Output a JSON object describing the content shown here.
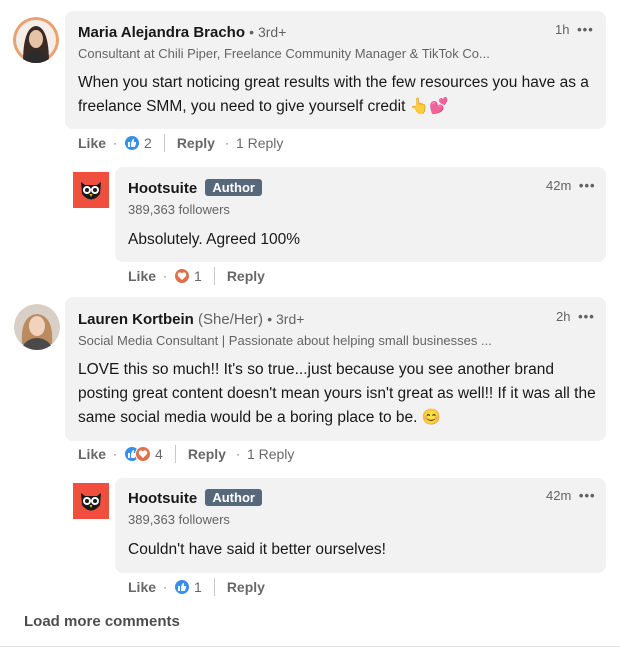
{
  "comments": [
    {
      "name": "Maria Alejandra Bracho",
      "degree": "• 3rd+",
      "headline": "Consultant at Chili Piper, Freelance Community Manager & TikTok Co...",
      "time": "1h",
      "more": "•••",
      "text": "When you start noticing great results with the few resources you have as a freelance SMM, you need to give yourself credit 👆💕",
      "like_label": "Like",
      "reaction_count": "2",
      "reply_label": "Reply",
      "reply_count": "1 Reply",
      "reply": {
        "name": "Hootsuite",
        "badge": "Author",
        "followers": "389,363 followers",
        "time": "42m",
        "more": "•••",
        "text": "Absolutely. Agreed 100%",
        "like_label": "Like",
        "reaction_count": "1",
        "reply_label": "Reply"
      }
    },
    {
      "name": "Lauren Kortbein",
      "pronouns": "(She/Her)",
      "degree": "• 3rd+",
      "headline": "Social Media Consultant | Passionate about helping small businesses ...",
      "time": "2h",
      "more": "•••",
      "text": "LOVE this so much!! It's so true...just because you see another brand posting great content doesn't mean yours isn't great as well!! If it was all the same social media would be a boring place to be. 😊",
      "like_label": "Like",
      "reaction_count": "4",
      "reply_label": "Reply",
      "reply_count": "1 Reply",
      "reply": {
        "name": "Hootsuite",
        "badge": "Author",
        "followers": "389,363 followers",
        "time": "42m",
        "more": "•••",
        "text": "Couldn't have said it better ourselves!",
        "like_label": "Like",
        "reaction_count": "1",
        "reply_label": "Reply"
      }
    }
  ],
  "load_more": "Load more comments",
  "colors": {
    "bubble": "#f2f2f2",
    "like_blue": "#378fe9",
    "love_red": "#df704d",
    "hootsuite_red": "#f04f3f",
    "author_badge": "#56687a"
  },
  "icons": {
    "like": "thumbs-up-icon",
    "love": "heart-icon",
    "more": "more-icon",
    "logo": "hootsuite-owl-logo"
  }
}
